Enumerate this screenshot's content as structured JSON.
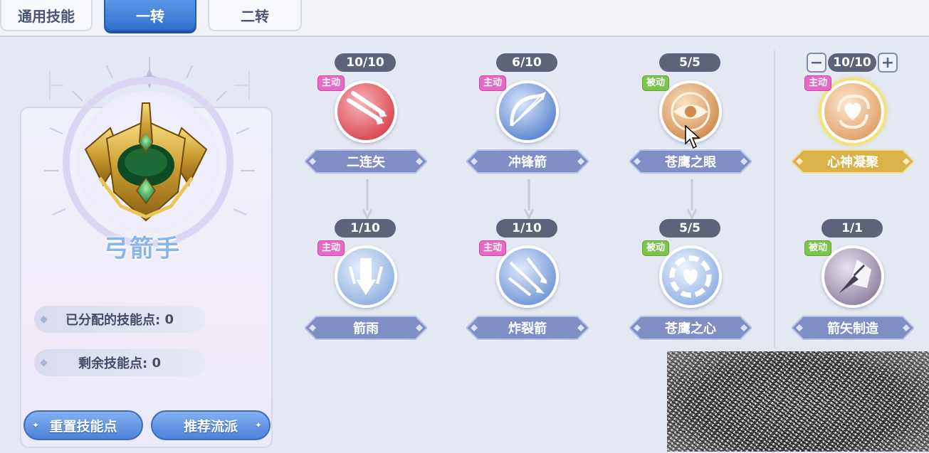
{
  "tabs": [
    {
      "label": "通用技能",
      "active": false
    },
    {
      "label": "一转",
      "active": true
    },
    {
      "label": "二转",
      "active": false
    }
  ],
  "character": {
    "class_name": "弓箭手",
    "allocated_points_label": "已分配的技能点:",
    "allocated_points": "0",
    "remaining_points_label": "剩余技能点:",
    "remaining_points": "0"
  },
  "buttons": {
    "reset": "重置技能点",
    "recommend": "推荐流派"
  },
  "skills": [
    {
      "name": "二连矢",
      "level": "10/10",
      "type": "主动",
      "icon": "double-arrow-icon"
    },
    {
      "name": "冲锋箭",
      "level": "6/10",
      "type": "主动",
      "icon": "bow-icon"
    },
    {
      "name": "苍鹰之眼",
      "level": "5/5",
      "type": "被动",
      "icon": "eye-icon"
    },
    {
      "name": "心神凝聚",
      "level": "10/10",
      "type": "主动",
      "icon": "heart-swirl-icon",
      "selected": true
    },
    {
      "name": "箭雨",
      "level": "1/10",
      "type": "主动",
      "icon": "arrow-rain-icon"
    },
    {
      "name": "炸裂箭",
      "level": "1/10",
      "type": "主动",
      "icon": "burst-arrow-icon"
    },
    {
      "name": "苍鹰之心",
      "level": "5/5",
      "type": "被动",
      "icon": "heart-shield-icon"
    },
    {
      "name": "箭矢制造",
      "level": "1/1",
      "type": "被动",
      "icon": "arrowhead-craft-icon"
    }
  ],
  "colors": {
    "active_tag": "#e868c8",
    "passive_tag": "#7cc44c",
    "name_bar": "#7f8ec4",
    "name_bar_selected": "#d9b24a",
    "level_badge": "#5d6378",
    "tab_active": "#2f6fd0"
  }
}
